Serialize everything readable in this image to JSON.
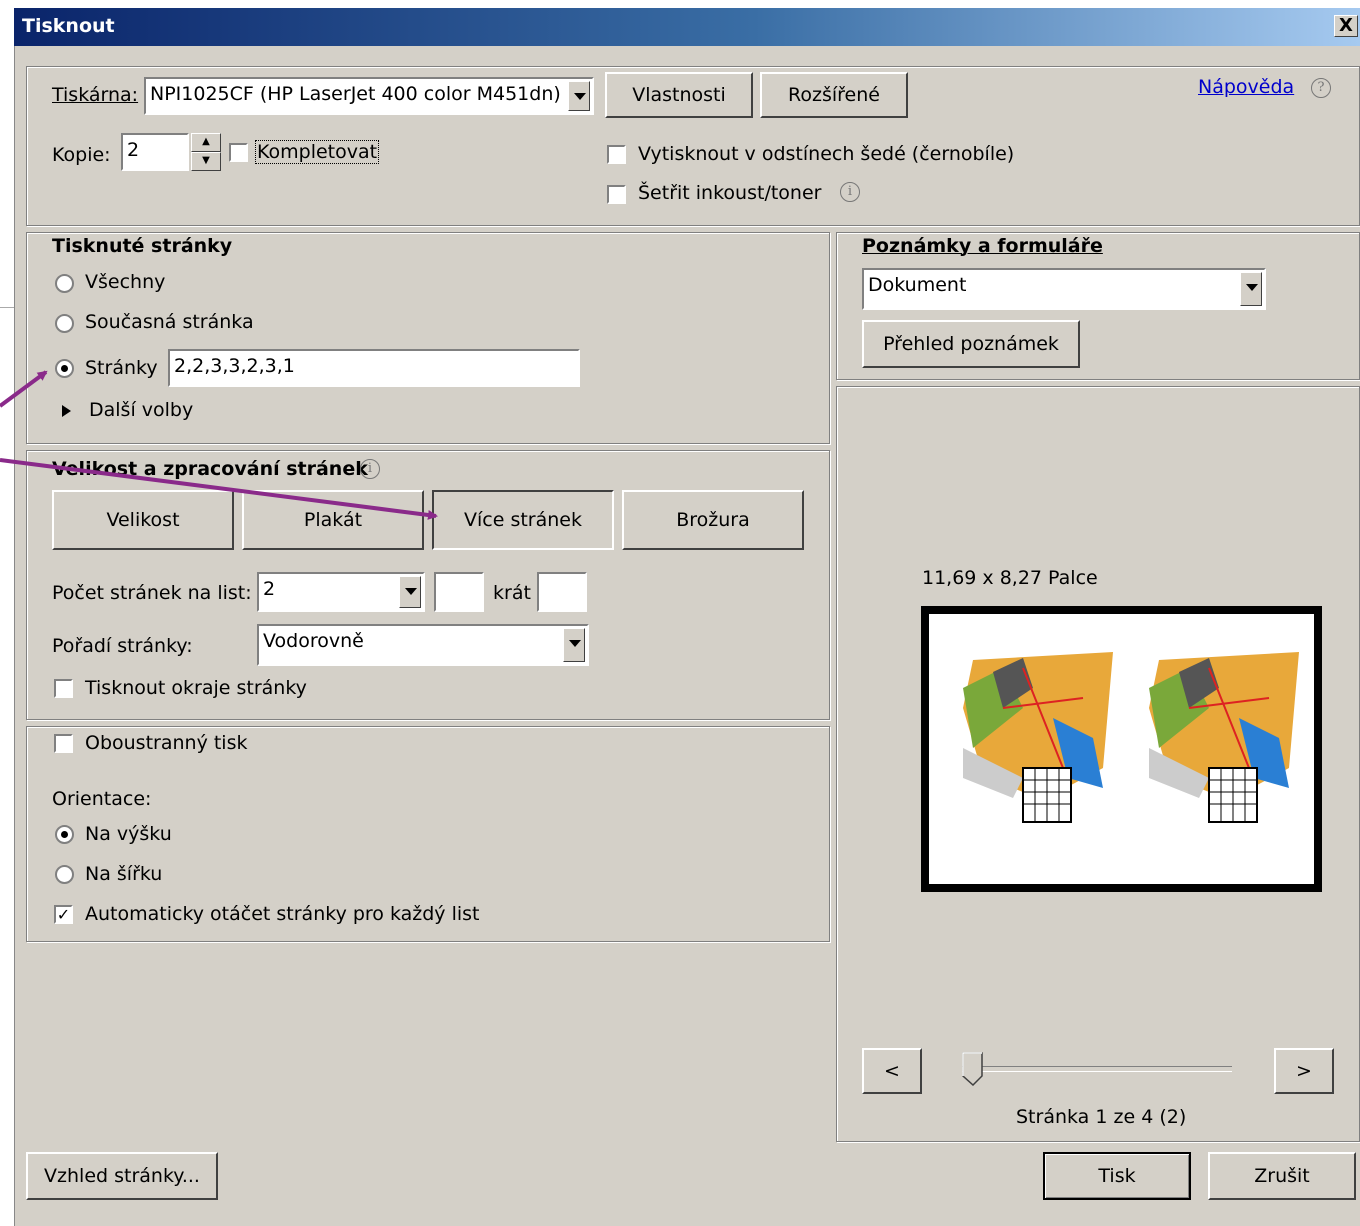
{
  "window": {
    "title": "Tisknout",
    "close_label": "X"
  },
  "printer": {
    "label": "Tiskárna:",
    "selected": "NPI1025CF (HP LaserJet 400 color M451dn)",
    "properties_button": "Vlastnosti",
    "advanced_button": "Rozšířené"
  },
  "help": {
    "label": "Nápověda",
    "icon": "question-icon"
  },
  "copies": {
    "label": "Kopie:",
    "value": "2",
    "collate_label": "Kompletovat",
    "collate_checked": false
  },
  "options": {
    "grayscale_label": "Vytisknout v odstínech šedé (černobíle)",
    "save_ink_label": "Šetřit inkoust/toner"
  },
  "pages": {
    "title": "Tisknuté stránky",
    "all_label": "Všechny",
    "current_label": "Současná stránka",
    "pages_label": "Stránky",
    "pages_value": "2,2,3,3,2,3,1",
    "selected": "pages",
    "more_options_label": "Další volby"
  },
  "sizing": {
    "title": "Velikost a zpracování stránek",
    "tabs": [
      "Velikost",
      "Plakát",
      "Více stránek",
      "Brožura"
    ],
    "active_tab": "Více stránek",
    "per_sheet_label": "Počet stránek na list:",
    "per_sheet_value": "2",
    "times_label": "krát",
    "order_label": "Pořadí stránky:",
    "order_value": "Vodorovně",
    "print_borders_label": "Tisknout okraje stránky"
  },
  "duplex": {
    "label": "Oboustranný tisk"
  },
  "orientation": {
    "label": "Orientace:",
    "portrait_label": "Na výšku",
    "landscape_label": "Na šířku",
    "selected": "portrait",
    "auto_rotate_label": "Automaticky otáčet stránky pro každý list",
    "auto_rotate_checked": true
  },
  "comments": {
    "title": "Poznámky a formuláře",
    "selected": "Dokument",
    "summary_button": "Přehled poznámek"
  },
  "preview": {
    "size_label": "11,69 x 8,27 Palce",
    "prev_label": "<",
    "next_label": ">",
    "page_status": "Stránka 1 ze 4 (2)",
    "slider_position": 0
  },
  "footer": {
    "page_setup_button": "Vzhled stránky...",
    "print_button": "Tisk",
    "cancel_button": "Zrušit"
  },
  "colors": {
    "annotation_arrow": "#8a2a8a",
    "title_gradient_start": "#0a246a"
  }
}
